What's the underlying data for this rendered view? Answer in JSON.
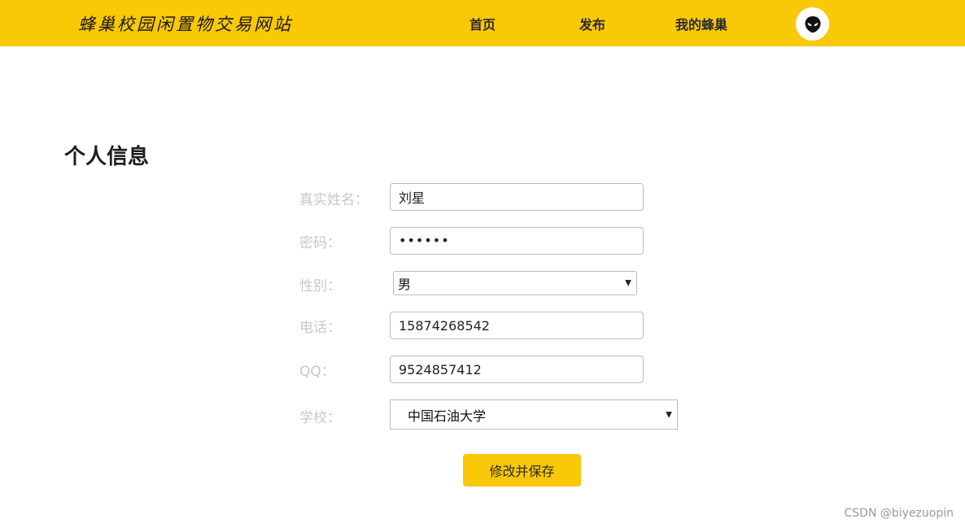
{
  "header": {
    "brand": "蜂巢校园闲置物交易网站",
    "nav": {
      "home": "首页",
      "publish": "发布",
      "my_nest": "我的蜂巢"
    },
    "avatar_icon": "alien-face-icon"
  },
  "page": {
    "title": "个人信息"
  },
  "form": {
    "real_name": {
      "label": "真实姓名：",
      "value": "刘星"
    },
    "password": {
      "label": "密码：",
      "value": "••••••"
    },
    "gender": {
      "label": "性别：",
      "selected": "男"
    },
    "phone": {
      "label": "电话：",
      "value": "15874268542"
    },
    "qq": {
      "label": "QQ：",
      "value": "9524857412"
    },
    "school": {
      "label": "学校：",
      "selected": "中国石油大学"
    },
    "save_label": "修改并保存"
  },
  "watermark": "CSDN @biyezuopin",
  "colors": {
    "accent": "#f9c806",
    "label_text": "#c8c8c8",
    "border": "#bcbcbc"
  }
}
